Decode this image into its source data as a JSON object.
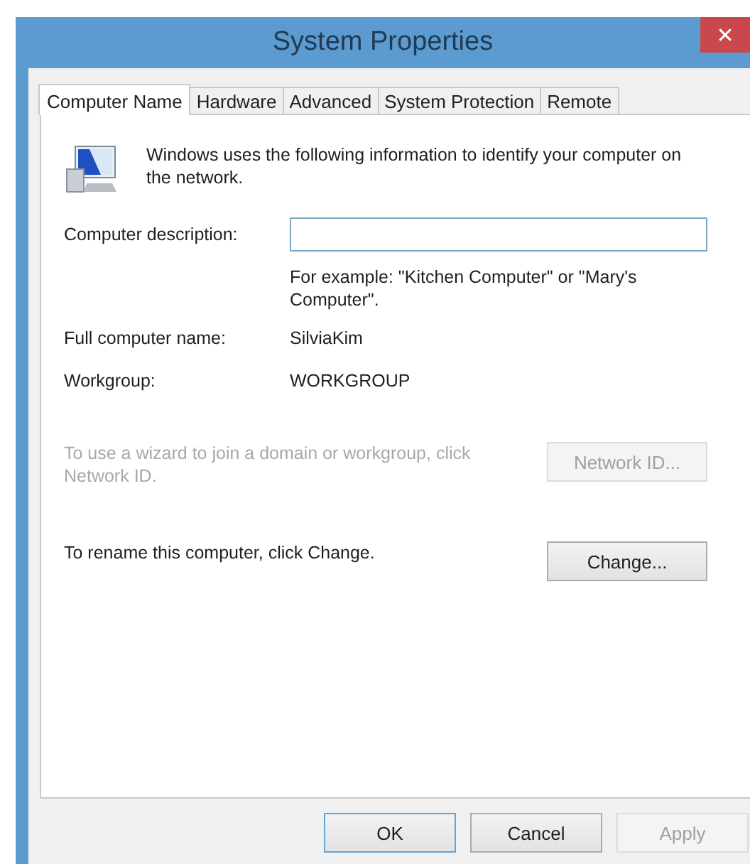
{
  "window": {
    "title": "System Properties",
    "close": "✕"
  },
  "tabs": [
    {
      "label": "Computer Name",
      "selected": true
    },
    {
      "label": "Hardware",
      "selected": false
    },
    {
      "label": "Advanced",
      "selected": false
    },
    {
      "label": "System Protection",
      "selected": false
    },
    {
      "label": "Remote",
      "selected": false
    }
  ],
  "intro": "Windows uses the following information to identify your computer on the network.",
  "description": {
    "label": "Computer description:",
    "hint": "For example: \"Kitchen Computer\" or \"Mary's Computer\"."
  },
  "full_name": {
    "label": "Full computer name:",
    "value": "SilviaKim"
  },
  "workgroup": {
    "label": "Workgroup:",
    "value": "WORKGROUP"
  },
  "network_id": {
    "text": "To use a wizard to join a domain or workgroup, click Network ID.",
    "button": "Network ID...",
    "disabled": true
  },
  "rename": {
    "text": "To rename this computer, click Change.",
    "button": "Change...",
    "disabled": false
  },
  "buttons": [
    {
      "label": "OK",
      "default": true,
      "disabled": false
    },
    {
      "label": "Cancel",
      "default": false,
      "disabled": false
    },
    {
      "label": "Apply",
      "default": false,
      "disabled": true
    }
  ]
}
